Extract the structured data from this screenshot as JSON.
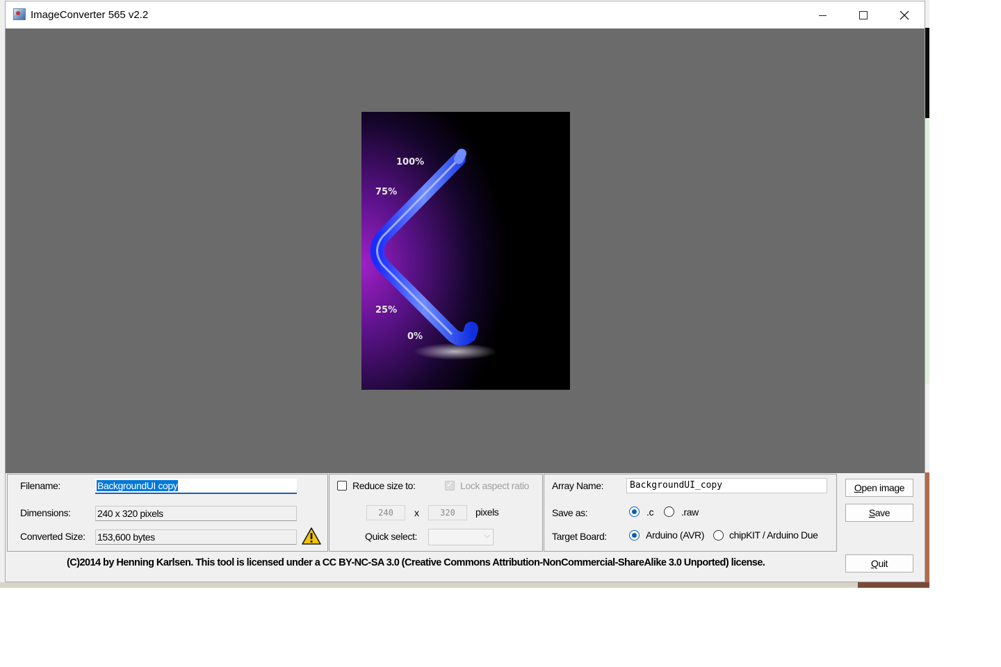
{
  "window": {
    "title": "ImageConverter 565 v2.2",
    "controls": [
      "minimize",
      "maximize",
      "close"
    ]
  },
  "preview": {
    "labels": [
      "100%",
      "75%",
      "25%",
      "0%"
    ],
    "background_color": "#000000",
    "accent_color": "#2a4fff"
  },
  "file_info": {
    "filename_label": "Filename:",
    "filename_value": "BackgroundUI copy",
    "dimensions_label": "Dimensions:",
    "dimensions_value": "240 x 320 pixels",
    "converted_label": "Converted Size:",
    "converted_value": "153,600 bytes"
  },
  "resize": {
    "reduce_label": "Reduce size to:",
    "reduce_checked": false,
    "lock_label": "Lock aspect ratio",
    "lock_checked": true,
    "width": "240",
    "x_label": "x",
    "height": "320",
    "pixels_label": "pixels",
    "quick_select_label": "Quick select:",
    "quick_select_value": ""
  },
  "output": {
    "array_label": "Array Name:",
    "array_value": "BackgroundUI_copy",
    "save_as_label": "Save as:",
    "save_as_options": [
      ".c",
      ".raw"
    ],
    "save_as_selected": ".c",
    "target_label": "Target Board:",
    "target_options": [
      "Arduino (AVR)",
      "chipKIT / Arduino Due"
    ],
    "target_selected": "Arduino (AVR)"
  },
  "buttons": {
    "open_image_accel": "O",
    "open_image_rest": "pen image",
    "save_accel": "S",
    "save_rest": "ave",
    "quit_accel": "Q",
    "quit_rest": "uit"
  },
  "license_text": "(C)2014 by Henning Karlsen. This tool is licensed under a CC BY-NC-SA 3.0 (Creative Commons Attribution-NonCommercial-ShareAlike 3.0 Unported) license.",
  "colors": {
    "canvas": "#6b6b6b",
    "selection": "#0078d7",
    "radio_on": "#0a5fb8",
    "warning": "#f5c400"
  }
}
